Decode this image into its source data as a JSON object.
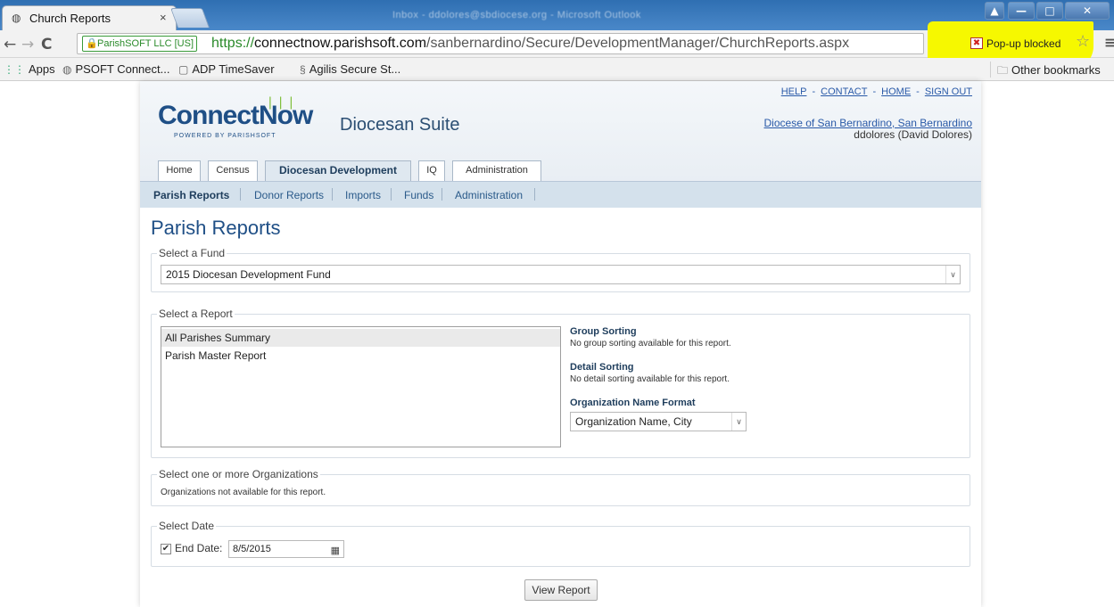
{
  "browser": {
    "tab_title": "Church Reports",
    "tab_close": "×",
    "background_window_text": "Inbox - ddolores@sbdiocese.org - Microsoft Outlook",
    "ssl_badge": "ParishSOFT LLC [US]",
    "url_scheme": "https://",
    "url_host": "connectnow.parishsoft.com",
    "url_path": "/sanbernardino/Secure/DevelopmentManager/ChurchReports.aspx",
    "popup_blocked": "Pop-up blocked",
    "highlight_color": "#f6f800",
    "bookmarks": [
      {
        "label": "Apps",
        "icon": "apps-grid-icon"
      },
      {
        "label": "PSOFT Connect...",
        "icon": "psoft-favicon"
      },
      {
        "label": "ADP TimeSaver",
        "icon": "page-icon"
      },
      {
        "label": "Agilis Secure St...",
        "icon": "agilis-icon"
      }
    ],
    "other_bookmarks": "Other bookmarks"
  },
  "header": {
    "logo_text": "Connect",
    "logo_now": "Now",
    "logo_sub": "POWERED BY PARISHSOFT",
    "suite_title": "Diocesan Suite",
    "top_links": [
      "HELP",
      "CONTACT",
      "HOME",
      "SIGN OUT"
    ],
    "top_link_sep": "-",
    "diocese_link": "Diocese of San Bernardino, San Bernardino",
    "user": "ddolores (David Dolores)"
  },
  "main_tabs": [
    "Home",
    "Census",
    "Diocesan Development",
    "IQ",
    "Administration"
  ],
  "sub_nav": [
    "Parish Reports",
    "Donor Reports",
    "Imports",
    "Funds",
    "Administration"
  ],
  "page": {
    "title": "Parish Reports",
    "fund_legend": "Select a Fund",
    "fund_value": "2015 Diocesan Development Fund",
    "report_legend": "Select a Report",
    "reports": [
      "All Parishes Summary",
      "Parish Master Report"
    ],
    "group_sorting_title": "Group Sorting",
    "group_sorting_text": "No group sorting available for this report.",
    "detail_sorting_title": "Detail Sorting",
    "detail_sorting_text": "No detail sorting available for this report.",
    "org_format_title": "Organization Name Format",
    "org_format_value": "Organization Name, City",
    "org_legend": "Select one or more Organizations",
    "org_text": "Organizations not available for this report.",
    "date_legend": "Select Date",
    "end_date_label": "End Date:",
    "end_date_value": "8/5/2015",
    "view_report": "View Report"
  },
  "colors": {
    "brand_blue": "#1f4f86",
    "subnav_bg": "#d4e1ec",
    "link_blue": "#2a5aa8"
  }
}
